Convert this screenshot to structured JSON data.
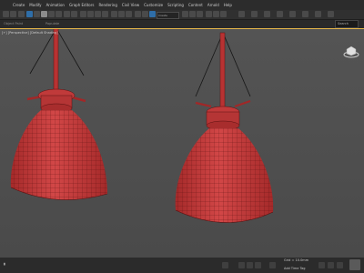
{
  "menu": [
    "Create",
    "Modify",
    "Animation",
    "Graph Editors",
    "Rendering",
    "Civil View",
    "Customize",
    "Scripting",
    "Content",
    "Arnold",
    "Help"
  ],
  "toolbar": {
    "selection_set": "Create Selection Set"
  },
  "ribbon": {
    "labels": [
      "Object Paint",
      "Populate"
    ],
    "search_placeholder": "Search"
  },
  "viewport": {
    "label": "[+] [Perspective] [Default Shading]",
    "active_border_color": "#e8b84a",
    "mesh_color": "#c63b3b"
  },
  "status": {
    "coords": "Grid = 10.0mm",
    "add_time_tag": "Add Time Tag"
  },
  "icons": [
    "viewcube-icon",
    "select-icon",
    "move-icon",
    "rotate-icon",
    "scale-icon",
    "render-icon",
    "play-icon",
    "zoom-icon"
  ]
}
